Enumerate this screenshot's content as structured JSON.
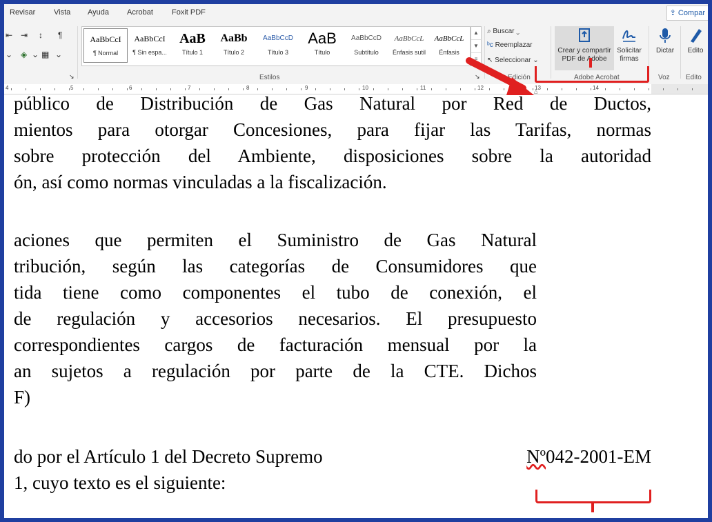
{
  "menu": {
    "items": [
      "Revisar",
      "Vista",
      "Ayuda",
      "Acrobat",
      "Foxit PDF"
    ],
    "share_label": "Compar"
  },
  "ribbon": {
    "styles": [
      {
        "sample": "AaBbCcI",
        "name": "¶ Normal"
      },
      {
        "sample": "AaBbCcI",
        "name": "¶ Sin espa..."
      },
      {
        "sample": "AaB",
        "name": "Título 1"
      },
      {
        "sample": "AaBb",
        "name": "Título 2"
      },
      {
        "sample": "AaBbCcD",
        "name": "Título 3"
      },
      {
        "sample": "AaB",
        "name": "Título"
      },
      {
        "sample": "AaBbCcD",
        "name": "Subtítulo"
      },
      {
        "sample": "AaBbCcL",
        "name": "Énfasis sutil"
      },
      {
        "sample": "AaBbCcL",
        "name": "Énfasis"
      }
    ],
    "styles_group_label": "Estilos",
    "edit": {
      "search": "Buscar",
      "replace": "Reemplazar",
      "select": "Seleccionar",
      "group_label": "Edición"
    },
    "acrobat": {
      "create_share_line1": "Crear y compartir",
      "create_share_line2": "PDF de Adobe",
      "request_signatures_line1": "Solicitar",
      "request_signatures_line2": "firmas",
      "group_label": "Adobe Acrobat"
    },
    "voice": {
      "dictate": "Dictar",
      "group_label": "Voz"
    },
    "editor": {
      "label": "Edito",
      "group_label": "Edito"
    }
  },
  "ruler": {
    "numbers": [
      "4",
      "5",
      "6",
      "7",
      "8",
      "9",
      "10",
      "11",
      "12",
      "13",
      "14"
    ]
  },
  "document": {
    "paragraph1": [
      "público de Distribución de Gas Natural por Red de Ductos,",
      "mientos para otorgar Concesiones, para fijar las Tarifas, normas",
      "sobre protección del Ambiente, disposiciones sobre la autoridad",
      "ón, así como normas vinculadas a la fiscalización."
    ],
    "paragraph2": [
      "aciones que permiten el Suministro de Gas Natural",
      "tribución, según las categorías de Consumidores que",
      "tida tiene como componentes el tubo de conexión, el",
      "de regulación y accesorios necesarios. El presupuesto",
      "correspondientes cargos de facturación mensual por la",
      "an sujetos a regulación por parte de la CTE. Dichos",
      "F)"
    ],
    "paragraph3_line1_pre": "do por el Artículo 1 del Decreto Supremo ",
    "paragraph3_line1_num": "Nº",
    "paragraph3_line1_post": " 042-2001-EM",
    "paragraph3_line2": "1, cuyo texto es el siguiente:"
  },
  "colors": {
    "annotation": "#e02020",
    "border": "#1f3fa0",
    "accent": "#1e5aa8"
  }
}
